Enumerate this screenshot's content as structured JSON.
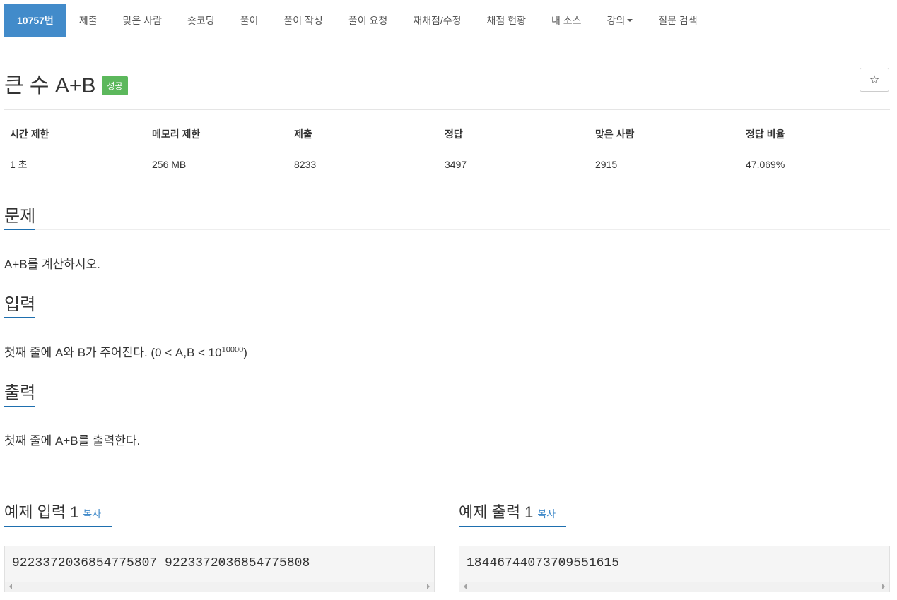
{
  "nav": {
    "items": [
      {
        "label": "10757번"
      },
      {
        "label": "제출"
      },
      {
        "label": "맞은 사람"
      },
      {
        "label": "숏코딩"
      },
      {
        "label": "풀이"
      },
      {
        "label": "풀이 작성"
      },
      {
        "label": "풀이 요청"
      },
      {
        "label": "재채점/수정"
      },
      {
        "label": "채점 현황"
      },
      {
        "label": "내 소스"
      },
      {
        "label": "강의"
      },
      {
        "label": "질문 검색"
      }
    ]
  },
  "problem": {
    "title": "큰 수 A+B",
    "badge": "성공",
    "star_icon": "☆"
  },
  "info_table": {
    "headers": [
      "시간 제한",
      "메모리 제한",
      "제출",
      "정답",
      "맞은 사람",
      "정답 비율"
    ],
    "row": [
      "1 초",
      "256 MB",
      "8233",
      "3497",
      "2915",
      "47.069%"
    ]
  },
  "sections": {
    "problem": {
      "title": "문제",
      "text": "A+B를 계산하시오."
    },
    "input": {
      "title": "입력",
      "text_before": "첫째 줄에 A와 B가 주어진다. (0 < A,B < 10",
      "exponent": "10000",
      "text_after": ")"
    },
    "output": {
      "title": "출력",
      "text": "첫째 줄에 A+B를 출력한다."
    }
  },
  "examples": {
    "input": {
      "title": "예제 입력 1",
      "copy": "복사",
      "value": "9223372036854775807 9223372036854775808"
    },
    "output": {
      "title": "예제 출력 1",
      "copy": "복사",
      "value": "18446744073709551615"
    }
  },
  "colors": {
    "active_tab": "#428bca",
    "success_badge": "#5cb85c",
    "accent": "#1e6faf"
  }
}
